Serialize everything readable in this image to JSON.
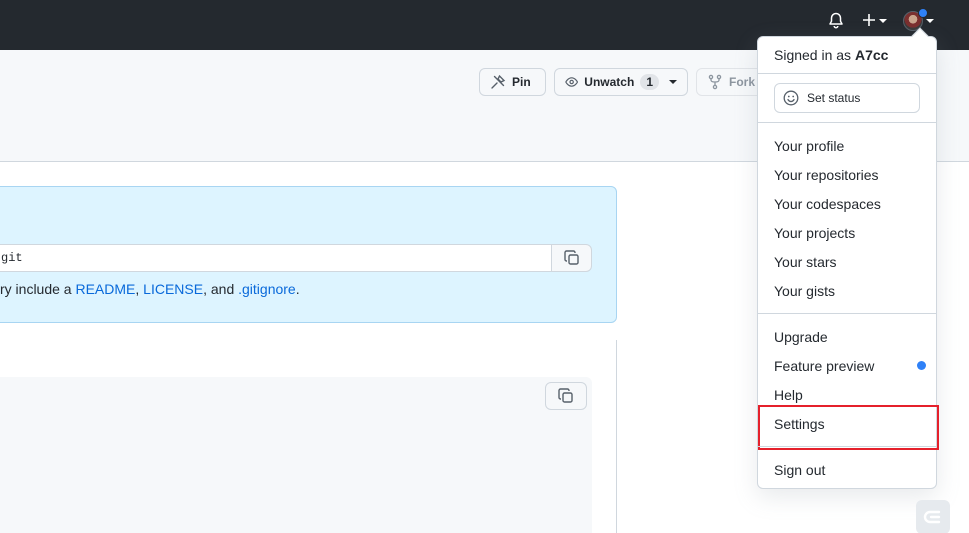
{
  "header": {
    "icons": [
      "bell-icon",
      "plus-icon",
      "avatar"
    ],
    "accent": "#2f81f7"
  },
  "repo_actions": {
    "pin_label": "Pin",
    "unwatch_label": "Unwatch",
    "unwatch_count": "1",
    "fork_label": "Fork"
  },
  "setup": {
    "clone_url_visible": "git",
    "text_prefix": "ry include a ",
    "readme_link": "README",
    "comma": ", ",
    "license_link": "LICENSE",
    "and_text": ", and ",
    "gitignore_link": ".gitignore",
    "period": "."
  },
  "menu": {
    "signed_in_prefix": "Signed in as ",
    "username": "A7cc",
    "set_status": "Set status",
    "items_group1": [
      "Your profile",
      "Your repositories",
      "Your codespaces",
      "Your projects",
      "Your stars",
      "Your gists"
    ],
    "upgrade": "Upgrade",
    "feature_preview": "Feature preview",
    "help": "Help",
    "settings": "Settings",
    "sign_out": "Sign out"
  },
  "colors": {
    "highlight_border": "#e5202b",
    "link": "#0969da",
    "setup_bg": "#ddf4ff"
  }
}
